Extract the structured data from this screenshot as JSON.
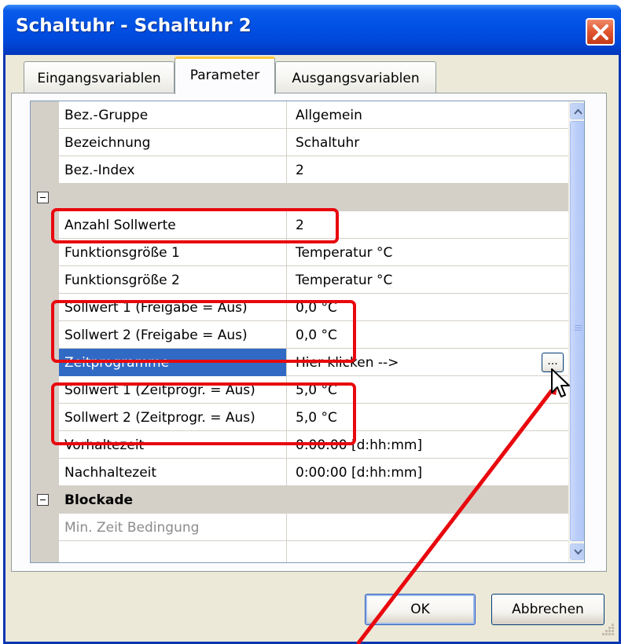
{
  "window": {
    "title": "Schaltuhr - Schaltuhr 2"
  },
  "tabs": [
    {
      "label": "Eingangsvariablen",
      "active": false
    },
    {
      "label": "Parameter",
      "active": true
    },
    {
      "label": "Ausgangsvariablen",
      "active": false
    }
  ],
  "grid": {
    "rows": [
      {
        "name": "Bez.-Gruppe",
        "value": "Allgemein"
      },
      {
        "name": "Bezeichnung",
        "value": "Schaltuhr"
      },
      {
        "name": "Bez.-Index",
        "value": "2"
      },
      {
        "name": "",
        "value": "",
        "group": true
      },
      {
        "name": "Anzahl Sollwerte",
        "value": "2"
      },
      {
        "name": "Funktionsgröße 1",
        "value": "Temperatur °C"
      },
      {
        "name": "Funktionsgröße 2",
        "value": "Temperatur °C"
      },
      {
        "name": "Sollwert 1 (Freigabe = Aus)",
        "value": "0,0 °C"
      },
      {
        "name": "Sollwert 2 (Freigabe = Aus)",
        "value": "0,0 °C"
      },
      {
        "name": "Zeitprogramme",
        "value": "Hier klicken -->",
        "selected": true,
        "button": "..."
      },
      {
        "name": "Sollwert 1 (Zeitprogr. = Aus)",
        "value": "5,0 °C"
      },
      {
        "name": "Sollwert 2 (Zeitprogr. = Aus)",
        "value": "5,0 °C"
      },
      {
        "name": "Vorhaltezeit",
        "value": "0:00:00 [d:hh:mm]"
      },
      {
        "name": "Nachhaltezeit",
        "value": "0:00:00 [d:hh:mm]"
      },
      {
        "name": "Blockade",
        "value": "",
        "group": true
      },
      {
        "name": "Min. Zeit Bedingung",
        "value": "",
        "disabled": true
      }
    ]
  },
  "buttons": {
    "ok": "OK",
    "cancel": "Abbrechen"
  },
  "colors": {
    "title_bar": "#0050E4",
    "selection": "#316AC5",
    "annotation": "#E8080E"
  },
  "icons": [
    "close-icon",
    "scroll-up-icon",
    "scroll-down-icon",
    "collapse-icon",
    "mouse-pointer-icon",
    "resize-grip-icon"
  ]
}
